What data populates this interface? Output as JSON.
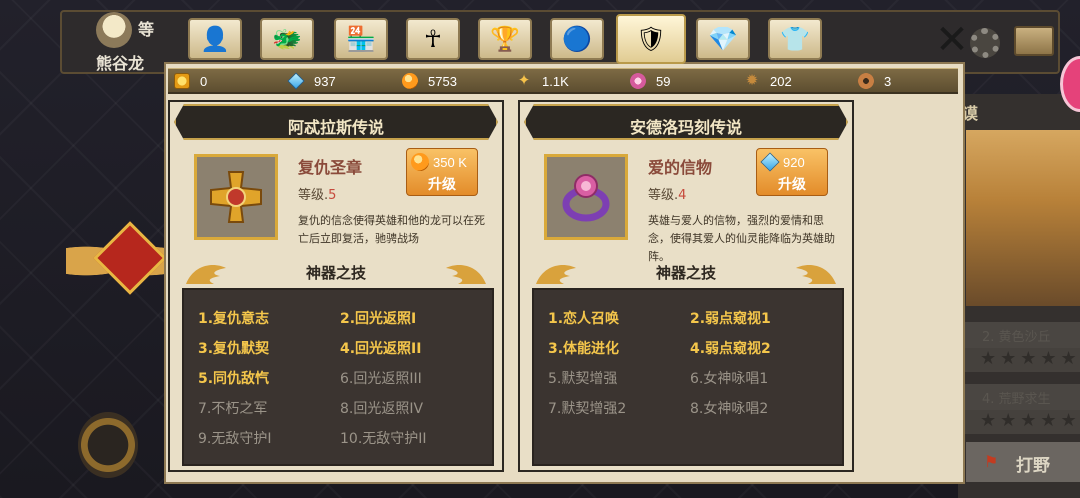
{
  "background": {
    "player_name": "熊谷龙",
    "level_char": "等",
    "right_title": "谟",
    "row1": "2. 黄色沙丘",
    "row2": "4. 荒野求生",
    "fight_label": "打野"
  },
  "tabs": [
    {
      "name": "hero-tab",
      "glyph": "👤"
    },
    {
      "name": "dragon-tab",
      "glyph": "🐲"
    },
    {
      "name": "shop-tab",
      "glyph": "🏪"
    },
    {
      "name": "ankh-tab",
      "glyph": "☥"
    },
    {
      "name": "trophy-tab",
      "glyph": "🏆"
    },
    {
      "name": "orb-tab",
      "glyph": "🔵"
    },
    {
      "name": "artifact-tab",
      "glyph": "🛡"
    },
    {
      "name": "crystal-tab",
      "glyph": "💎"
    },
    {
      "name": "costume-tab",
      "glyph": "👕"
    }
  ],
  "currencies": [
    {
      "icon": "gold-coin-icon",
      "value": "0"
    },
    {
      "icon": "gem-icon",
      "value": "937"
    },
    {
      "icon": "orb-icon",
      "value": "5753"
    },
    {
      "icon": "star-shard-icon",
      "value": "1.1K"
    },
    {
      "icon": "flower-icon",
      "value": "59"
    },
    {
      "icon": "claw-icon",
      "value": "202"
    },
    {
      "icon": "donut-icon",
      "value": "3"
    }
  ],
  "panels": [
    {
      "title": "阿忒拉斯传说",
      "item_name": "复仇圣章",
      "level_label": "等级.",
      "level": "5",
      "cost": "350 K",
      "cost_icon": "orb-icon",
      "upgrade_label": "升级",
      "description": "复仇的信念使得英雄和他的龙可以在死亡后立即复活，驰骋战场",
      "skill_title": "神器之技",
      "skills": [
        {
          "text": "1.复仇意志",
          "active": true
        },
        {
          "text": "2.回光返照I",
          "active": true
        },
        {
          "text": "3.复仇默契",
          "active": true
        },
        {
          "text": "4.回光返照II",
          "active": true
        },
        {
          "text": "5.同仇敌忾",
          "active": true
        },
        {
          "text": "6.回光返照III",
          "active": false
        },
        {
          "text": "7.不朽之军",
          "active": false
        },
        {
          "text": "8.回光返照IV",
          "active": false
        },
        {
          "text": "9.无敌守护I",
          "active": false
        },
        {
          "text": "10.无敌守护II",
          "active": false
        }
      ]
    },
    {
      "title": "安德洛玛刻传说",
      "item_name": "爱的信物",
      "level_label": "等级.",
      "level": "4",
      "cost": "920",
      "cost_icon": "gem-icon",
      "upgrade_label": "升级",
      "description": "英雄与爱人的信物，强烈的爱情和思念，使得其爱人的仙灵能降临为英雄助阵。",
      "skill_title": "神器之技",
      "skills": [
        {
          "text": "1.恋人召唤",
          "active": true
        },
        {
          "text": "2.弱点窥视1",
          "active": true
        },
        {
          "text": "3.体能进化",
          "active": true
        },
        {
          "text": "4.弱点窥视2",
          "active": true
        },
        {
          "text": "5.默契增强",
          "active": false
        },
        {
          "text": "6.女神咏唱1",
          "active": false
        },
        {
          "text": "7.默契增强2",
          "active": false
        },
        {
          "text": "8.女神咏唱2",
          "active": false
        }
      ]
    }
  ],
  "colors": {
    "accent": "#f4c64b",
    "dim": "#9b9489",
    "panel_bg": "#e9dfc7"
  }
}
